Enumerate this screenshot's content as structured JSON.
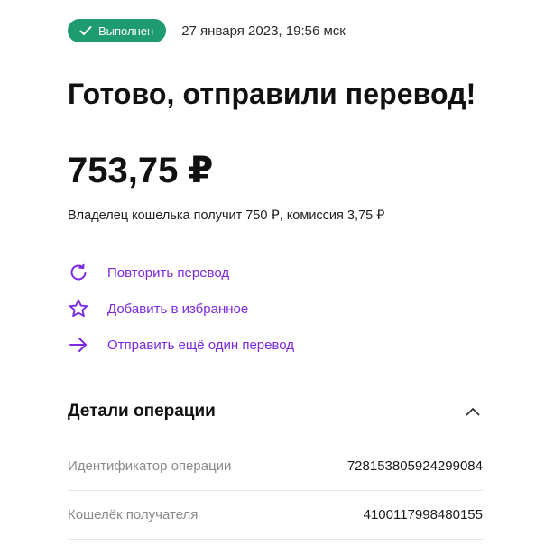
{
  "status": {
    "badge_label": "Выполнен",
    "badge_color": "#1e9c6f",
    "timestamp": "27 января 2023, 19:56 мск"
  },
  "title": "Готово, отправили перевод!",
  "amount": "753,75 ₽",
  "subtext": "Владелец кошелька получит 750 ₽, комиссия 3,75 ₽",
  "accent_color": "#7b2ae0",
  "actions": [
    {
      "icon": "refresh-icon",
      "label": "Повторить перевод"
    },
    {
      "icon": "star-icon",
      "label": "Добавить в избранное"
    },
    {
      "icon": "arrow-right-icon",
      "label": "Отправить ещё один перевод"
    }
  ],
  "details": {
    "title": "Детали операции",
    "expanded": true,
    "rows": [
      {
        "key": "Идентификатор операции",
        "value": "728153805924299084"
      },
      {
        "key": "Кошелёк получателя",
        "value": "4100117998480155"
      }
    ]
  }
}
